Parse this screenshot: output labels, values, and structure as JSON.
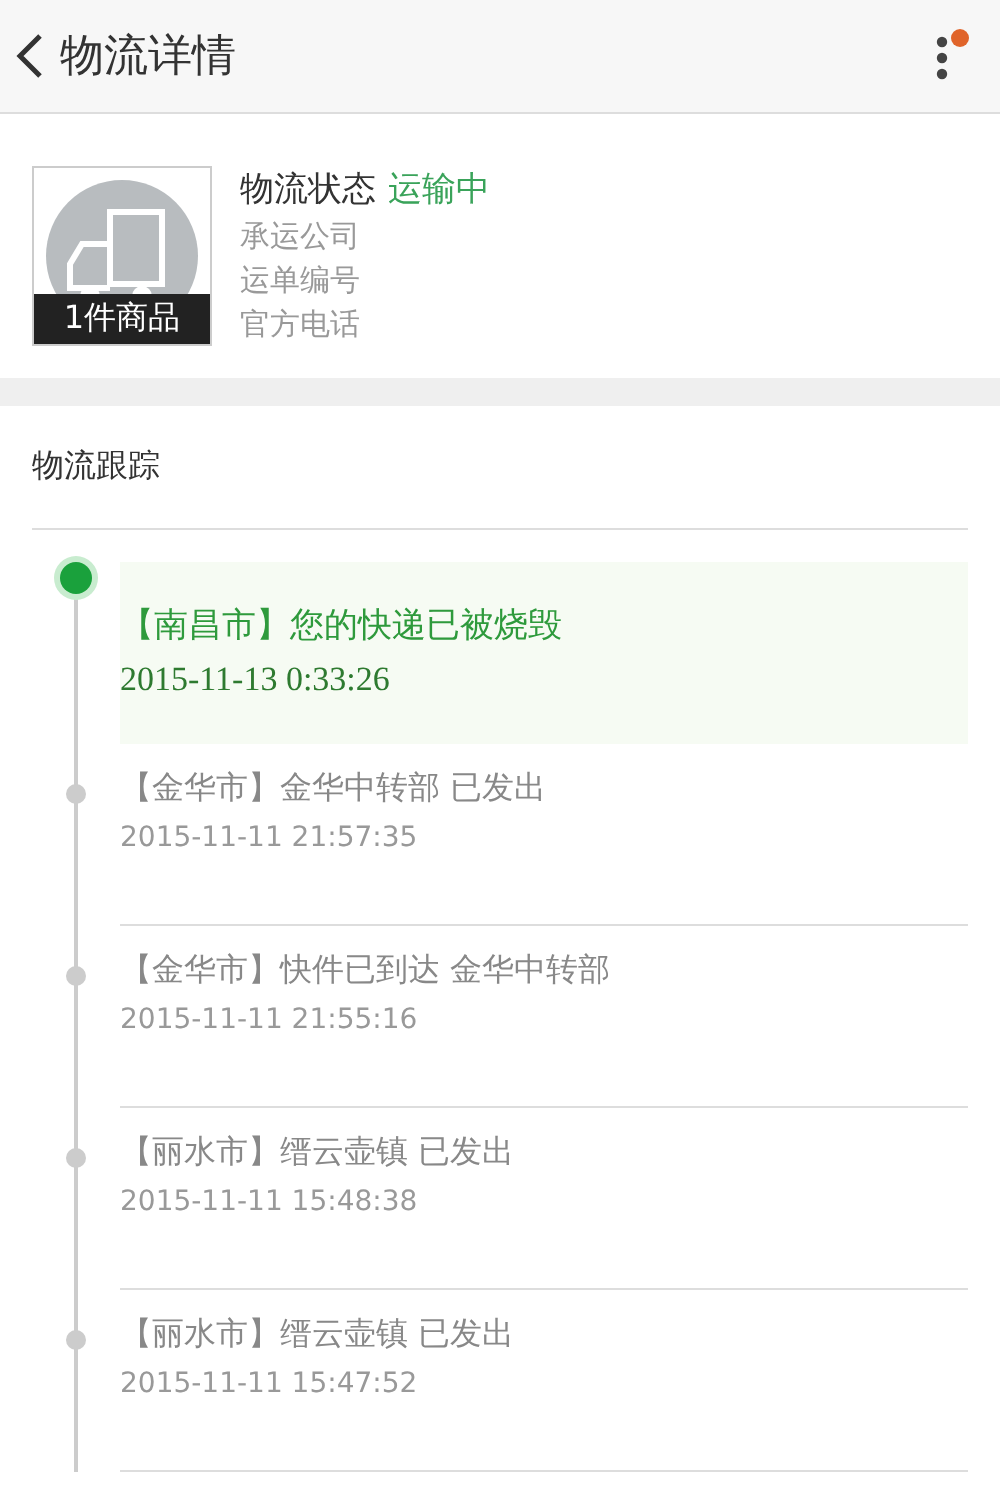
{
  "header": {
    "title": "物流详情",
    "has_notification": true
  },
  "package": {
    "status_label": "物流状态",
    "status": "运输中",
    "fields": [
      "承运公司",
      "运单编号",
      "官方电话"
    ],
    "item_count": "1件商品"
  },
  "tracking": {
    "title": "物流跟踪",
    "events": [
      {
        "text": "【南昌市】您的快递已被烧毁",
        "time": "2015-11-13   0:33:26",
        "current": true
      },
      {
        "text": "【金华市】金华中转部 已发出",
        "time": "2015-11-11 21:57:35",
        "current": false
      },
      {
        "text": "【金华市】快件已到达 金华中转部",
        "time": "2015-11-11 21:55:16",
        "current": false
      },
      {
        "text": "【丽水市】缙云壶镇 已发出",
        "time": "2015-11-11 15:48:38",
        "current": false
      },
      {
        "text": "【丽水市】缙云壶镇 已发出",
        "time": "2015-11-11 15:47:52",
        "current": false
      }
    ]
  }
}
